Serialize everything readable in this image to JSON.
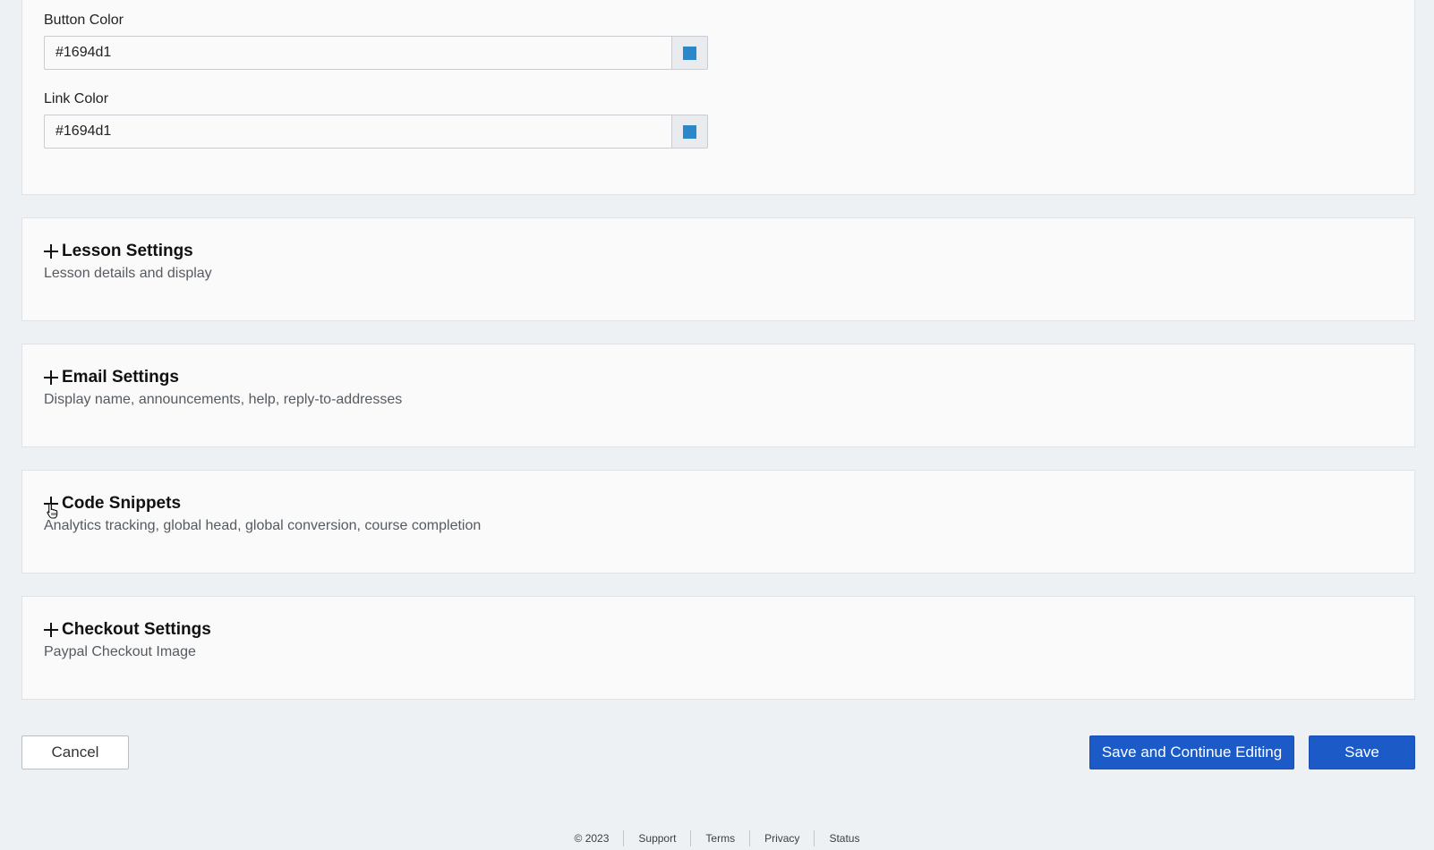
{
  "colors_card": {
    "button_color": {
      "label": "Button Color",
      "value": "#1694d1",
      "swatch": "#2a87c9"
    },
    "link_color": {
      "label": "Link Color",
      "value": "#1694d1",
      "swatch": "#2a87c9"
    }
  },
  "sections": [
    {
      "title": "Lesson Settings",
      "description": "Lesson details and display"
    },
    {
      "title": "Email Settings",
      "description": "Display name, announcements, help, reply-to-addresses"
    },
    {
      "title": "Code Snippets",
      "description": "Analytics tracking, global head, global conversion, course completion"
    },
    {
      "title": "Checkout Settings",
      "description": "Paypal Checkout Image"
    }
  ],
  "actions": {
    "cancel_label": "Cancel",
    "save_continue_label": "Save and Continue Editing",
    "save_label": "Save"
  },
  "footer": {
    "copyright": "© 2023",
    "links": [
      "Support",
      "Terms",
      "Privacy",
      "Status"
    ]
  },
  "theme": {
    "primary": "#1c5bc7",
    "background": "#eef1f4",
    "card": "#fafafa"
  }
}
